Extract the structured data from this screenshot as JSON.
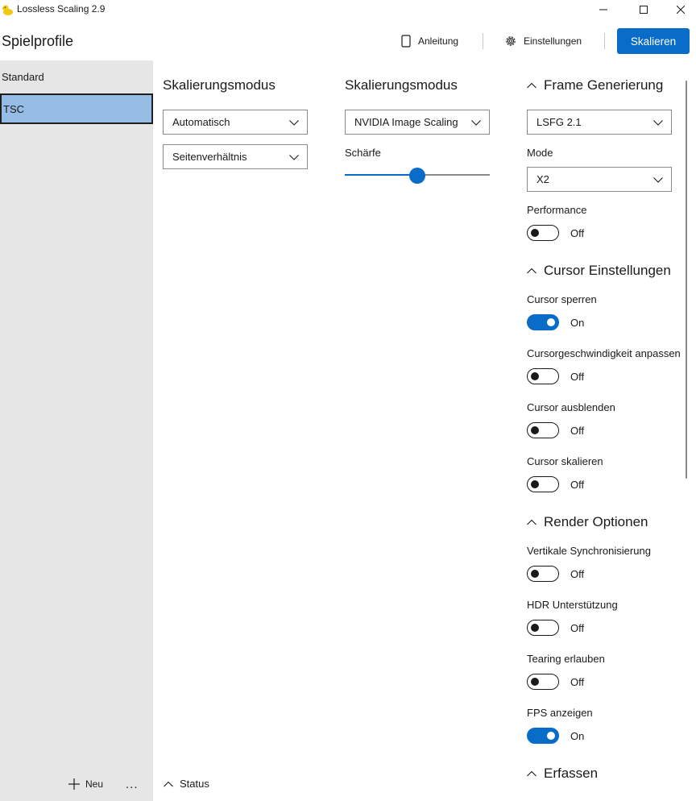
{
  "window": {
    "title": "Lossless Scaling 2.9"
  },
  "header": {
    "title": "Spielprofile",
    "guide_label": "Anleitung",
    "settings_label": "Einstellungen",
    "scale_label": "Skalieren"
  },
  "sidebar": {
    "profiles": [
      {
        "label": "Standard"
      },
      {
        "label": "TSC",
        "selected": true
      }
    ],
    "new_label": "Neu",
    "more_label": "..."
  },
  "scaling_left": {
    "heading": "Skalierungsmodus",
    "mode_value": "Automatisch",
    "aspect_value": "Seitenverhältnis"
  },
  "scaling_right": {
    "heading": "Skalierungsmodus",
    "type_value": "NVIDIA Image Scaling",
    "sharpness_label": "Schärfe",
    "sharpness_fraction": 0.5
  },
  "frame_generation": {
    "heading": "Frame Generierung",
    "type_value": "LSFG 2.1",
    "mode_label": "Mode",
    "mode_value": "X2",
    "performance_label": "Performance",
    "performance_state": "Off"
  },
  "cursor": {
    "heading": "Cursor Einstellungen",
    "items": [
      {
        "label": "Cursor sperren",
        "state": "On"
      },
      {
        "label": "Cursorgeschwindigkeit anpassen",
        "state": "Off"
      },
      {
        "label": "Cursor ausblenden",
        "state": "Off"
      },
      {
        "label": "Cursor skalieren",
        "state": "Off"
      }
    ]
  },
  "render": {
    "heading": "Render Optionen",
    "items": [
      {
        "label": "Vertikale Synchronisierung",
        "state": "Off"
      },
      {
        "label": "HDR Unterstützung",
        "state": "Off"
      },
      {
        "label": "Tearing erlauben",
        "state": "Off"
      },
      {
        "label": "FPS anzeigen",
        "state": "On"
      }
    ]
  },
  "capture": {
    "heading": "Erfassen"
  },
  "status": {
    "label": "Status"
  },
  "colors": {
    "accent": "#0a6cc9",
    "selected_profile": "#94bce4",
    "sidebar_bg": "#e6e6e6"
  }
}
